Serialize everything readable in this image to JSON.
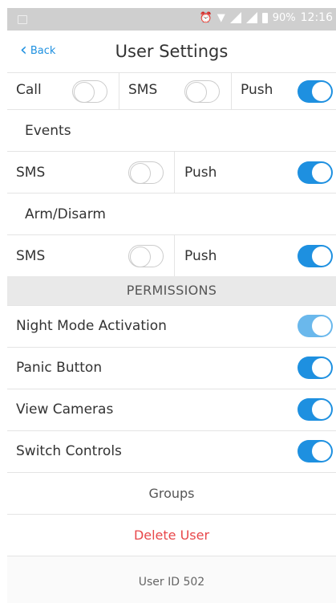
{
  "status": {
    "battery": "90%",
    "time": "12:16"
  },
  "nav": {
    "back_label": "Back",
    "title": "User Settings"
  },
  "alerts": {
    "call_label": "Call",
    "call_on": false,
    "sms_label": "SMS",
    "sms_on": false,
    "push_label": "Push",
    "push_on": true
  },
  "events": {
    "heading": "Events",
    "sms_label": "SMS",
    "sms_on": false,
    "push_label": "Push",
    "push_on": true
  },
  "arm": {
    "heading": "Arm/Disarm",
    "sms_label": "SMS",
    "sms_on": false,
    "push_label": "Push",
    "push_on": true
  },
  "permissions": {
    "heading": "PERMISSIONS",
    "items": [
      {
        "label": "Night Mode Activation",
        "on": true
      },
      {
        "label": "Panic Button",
        "on": true
      },
      {
        "label": "View Cameras",
        "on": true
      },
      {
        "label": "Switch Controls",
        "on": true
      }
    ]
  },
  "groups_label": "Groups",
  "delete_label": "Delete User",
  "user_id": "User ID 502",
  "colors": {
    "accent": "#1e90e0",
    "danger": "#e8474a"
  }
}
